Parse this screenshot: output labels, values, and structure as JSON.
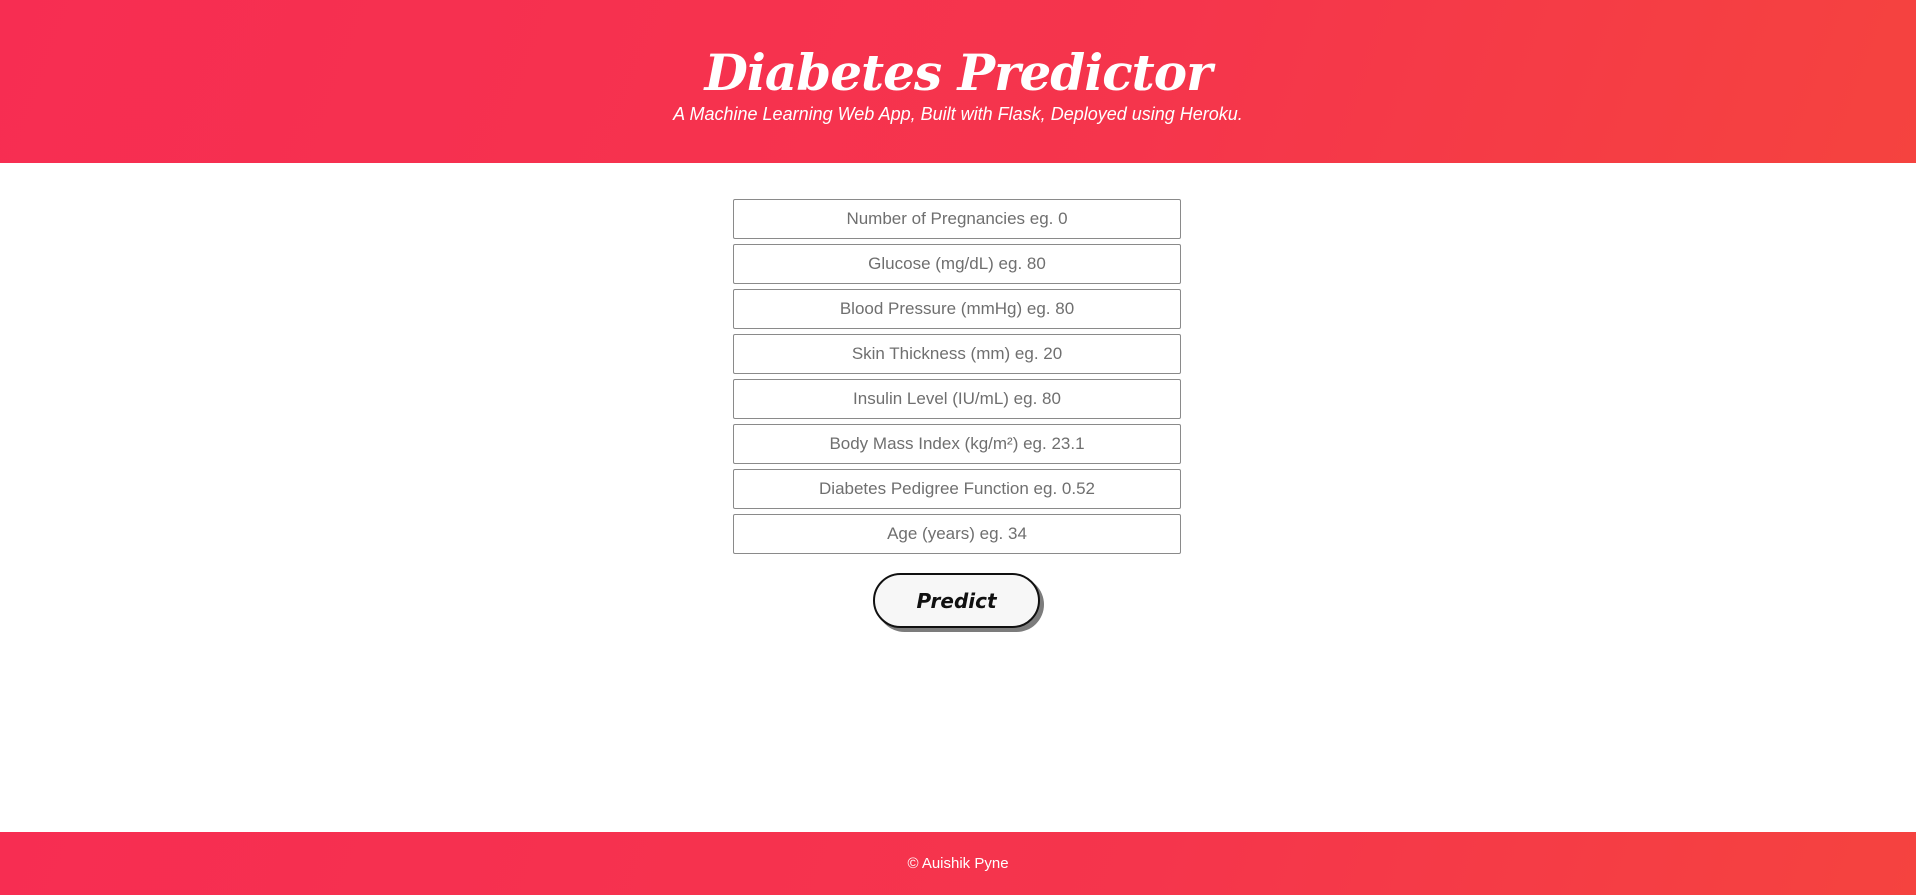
{
  "header": {
    "title": "Diabetes Predictor",
    "subtitle": "A Machine Learning Web App, Built with Flask, Deployed using Heroku."
  },
  "form": {
    "fields": [
      {
        "placeholder": "Number of Pregnancies eg. 0",
        "value": ""
      },
      {
        "placeholder": "Glucose (mg/dL) eg. 80",
        "value": ""
      },
      {
        "placeholder": "Blood Pressure (mmHg) eg. 80",
        "value": ""
      },
      {
        "placeholder": "Skin Thickness (mm) eg. 20",
        "value": ""
      },
      {
        "placeholder": "Insulin Level (IU/mL) eg. 80",
        "value": ""
      },
      {
        "placeholder": "Body Mass Index (kg/m²) eg. 23.1",
        "value": ""
      },
      {
        "placeholder": "Diabetes Pedigree Function eg. 0.52",
        "value": ""
      },
      {
        "placeholder": "Age (years) eg. 34",
        "value": ""
      }
    ],
    "submit_label": "Predict"
  },
  "footer": {
    "copyright": "© Auishik Pyne"
  },
  "colors": {
    "accent": "#f5354c",
    "accent_start": "#f72d52",
    "accent_end": "#f5433f"
  }
}
